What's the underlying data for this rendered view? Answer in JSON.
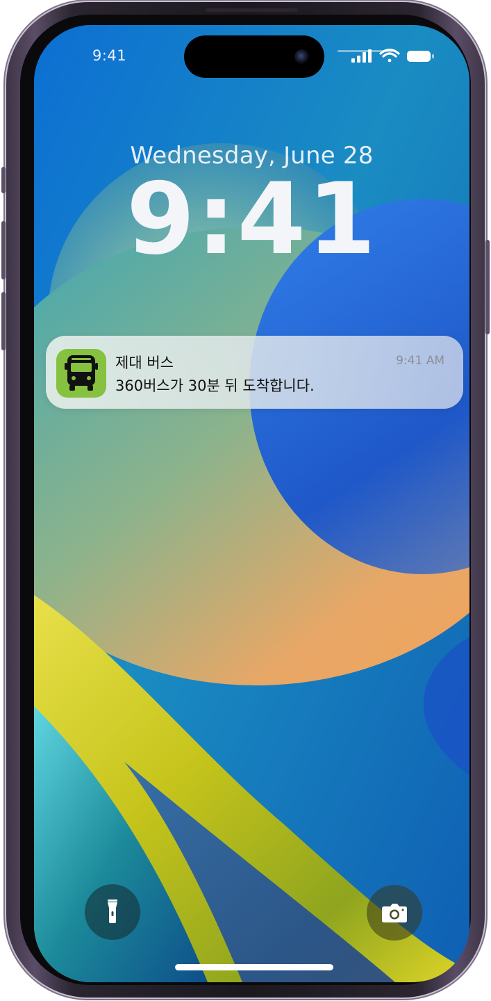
{
  "status_bar": {
    "time": "9:41",
    "icons": [
      "cellular-signal-icon",
      "wifi-icon",
      "battery-icon"
    ]
  },
  "lock_screen": {
    "date": "Wednesday, June 28",
    "time": "9:41"
  },
  "notification": {
    "app_icon": "bus-icon",
    "app_icon_color": "#86c13f",
    "title": "제대 버스",
    "body": "360버스가 30분 뒤 도착합니다.",
    "time": "9:41 AM"
  },
  "quick_actions": {
    "left": "flashlight-icon",
    "right": "camera-icon"
  },
  "colors": {
    "wallpaper_blue": "#1170c7",
    "wallpaper_orange": "#f2a25a",
    "wallpaper_yellow": "#d7d21e",
    "phone_frame": "#5a4d66"
  }
}
